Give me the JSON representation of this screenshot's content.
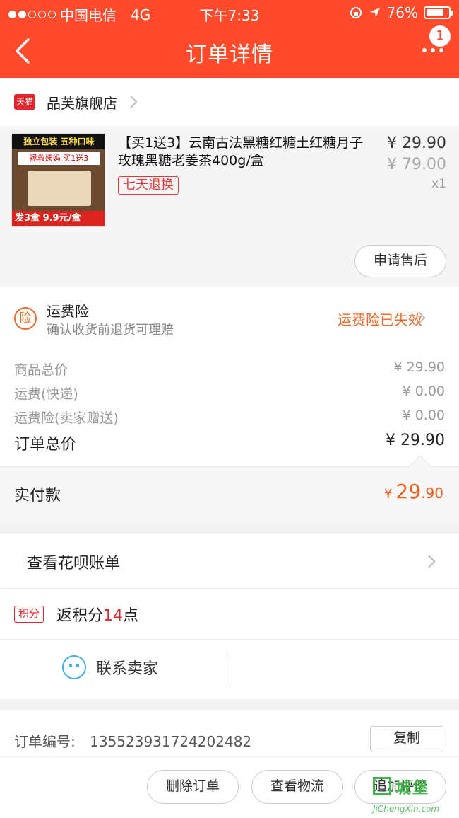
{
  "status_bar": {
    "carrier": "中国电信",
    "network": "4G",
    "time": "下午7:33",
    "battery": "76%"
  },
  "nav": {
    "title": "订单详情",
    "badge": "1"
  },
  "shop": {
    "logo_text": "天猫",
    "name": "品芙旗舰店"
  },
  "product": {
    "image_texts": {
      "top": "独立包装 五种口味",
      "mid": "拯救姨妈 买1送3",
      "bottom": "发3盒 9.9元/盒"
    },
    "name": "【买1送3】云南古法黑糖红糖土红糖月子玫瑰黑糖老姜茶400g/盒",
    "tag": "七天退换",
    "price": "¥ 29.90",
    "original_price": "¥ 79.00",
    "quantity": "x1",
    "after_sale_button": "申请售后"
  },
  "insurance": {
    "icon_text": "险",
    "title": "运费险",
    "subtitle": "确认收货前退货可理赔",
    "status": "运费险已失效"
  },
  "summary": {
    "rows": [
      {
        "label": "商品总价",
        "value": "¥ 29.90"
      },
      {
        "label": "运费(快递)",
        "value": "¥ 0.00"
      },
      {
        "label": "运费险(卖家赠送)",
        "value": "¥ 0.00"
      }
    ],
    "total_label": "订单总价",
    "total_value": "¥ 29.90"
  },
  "paid": {
    "label": "实付款",
    "currency": "¥",
    "integer": "29",
    "decimal": ".90"
  },
  "huabei": {
    "label": "查看花呗账单"
  },
  "points": {
    "tag": "积分",
    "prefix": "返积分",
    "number": "14",
    "suffix": "点"
  },
  "contact": {
    "label": "联系卖家"
  },
  "order": {
    "number_label": "订单编号:",
    "number": "135523931724202482",
    "copy_button": "复制"
  },
  "actions": {
    "delete": "删除订单",
    "logistics": "查看物流",
    "review": "追加评价"
  },
  "watermark": {
    "text": "城堡",
    "sub": "JiChengXin.com"
  },
  "colors": {
    "brand": "#ff4a2c",
    "accent_orange": "#f06a2c",
    "tmall_red": "#e4242b"
  }
}
